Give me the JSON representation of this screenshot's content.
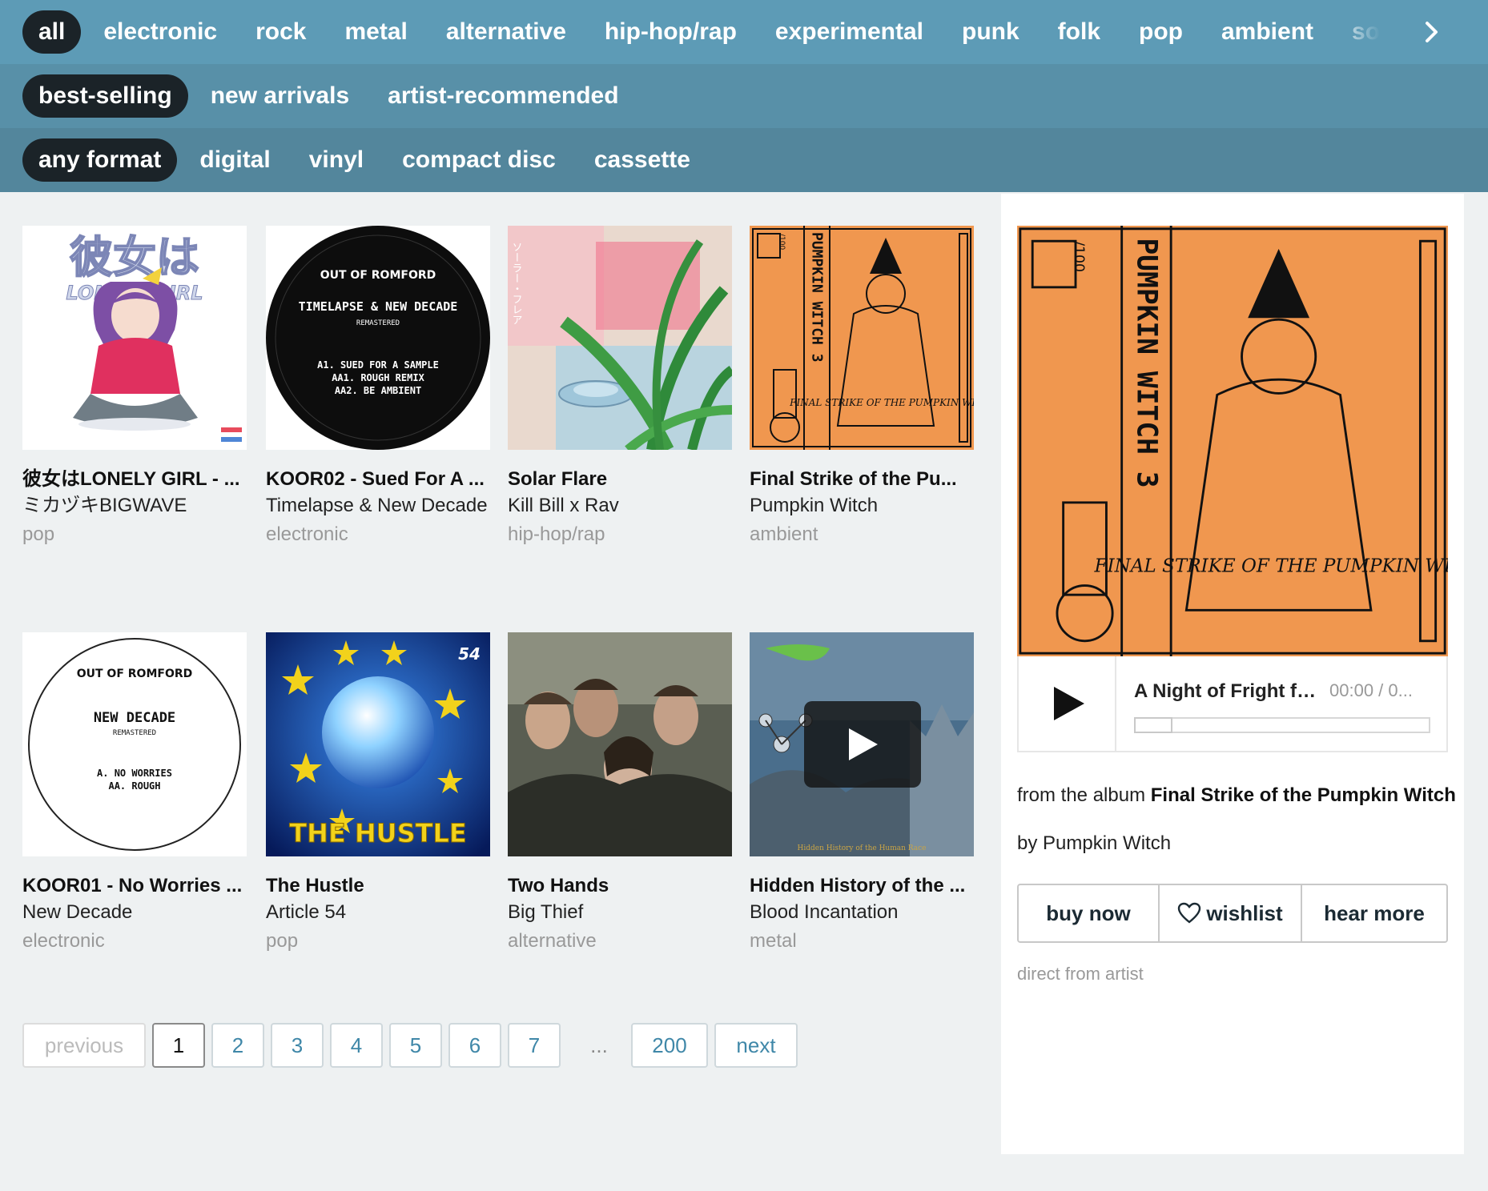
{
  "genre_tabs": [
    "all",
    "electronic",
    "rock",
    "metal",
    "alternative",
    "hip-hop/rap",
    "experimental",
    "punk",
    "folk",
    "pop",
    "ambient",
    "soundtra"
  ],
  "active_genre": "all",
  "sort_tabs": [
    "best-selling",
    "new arrivals",
    "artist-recommended"
  ],
  "format_tabs": [
    "any format",
    "digital",
    "vinyl",
    "compact disc",
    "cassette"
  ],
  "colors": {
    "bar_top": "#5d9bb6",
    "bar_mid": "#5890a8",
    "bar_bottom": "#53869c",
    "pill_active": "#1b2328",
    "link": "#3f87a8",
    "cover_orange": "#f0974f"
  },
  "items": [
    {
      "title": "彼女はLONELY GIRL - ...",
      "artist": "ミカヅキBIGWAVE",
      "genre": "pop"
    },
    {
      "title": "KOOR02 - Sued For A ...",
      "artist": "Timelapse & New Decade",
      "genre": "electronic"
    },
    {
      "title": "Solar Flare",
      "artist": "Kill Bill x Rav",
      "genre": "hip-hop/rap"
    },
    {
      "title": "Final Strike of the Pu...",
      "artist": "Pumpkin Witch",
      "genre": "ambient"
    },
    {
      "title": "KOOR01 - No Worries ...",
      "artist": "New Decade",
      "genre": "electronic"
    },
    {
      "title": "The Hustle",
      "artist": "Article 54",
      "genre": "pop"
    },
    {
      "title": "Two Hands",
      "artist": "Big Thief",
      "genre": "alternative"
    },
    {
      "title": "Hidden History of the ...",
      "artist": "Blood Incantation",
      "genre": "metal"
    }
  ],
  "covers": {
    "c1": {
      "jp_title": "彼女は",
      "en_sub": "LONELY GIRL"
    },
    "c2": {
      "label": "OUT OF ROMFORD",
      "title": "TIMELAPSE & NEW DECADE",
      "remastered": "REMASTERED",
      "tracks": [
        "A1. SUED FOR A SAMPLE",
        "AA1. ROUGH REMIX",
        "AA2. BE AMBIENT"
      ]
    },
    "c3": {
      "jp": "ソーラー・フレア"
    },
    "c4": {
      "spine": "PUMPKIN WITCH 3",
      "num": "/100",
      "art_text": "FINAL STRIKE OF THE PUMPKIN WITCH"
    },
    "c5": {
      "label": "OUT OF ROMFORD",
      "title": "NEW DECADE",
      "remastered": "REMASTERED",
      "tracks": [
        "A. NO WORRIES",
        "AA. ROUGH"
      ]
    },
    "c6": {
      "title": "THE HUSTLE",
      "badge": "54"
    },
    "c8": {
      "caption": "Hidden History of the Human Race"
    }
  },
  "pagination": {
    "previous": "previous",
    "pages": [
      "1",
      "2",
      "3",
      "4",
      "5",
      "6",
      "7"
    ],
    "current": "1",
    "ellipsis": "...",
    "last": "200",
    "next": "next"
  },
  "player": {
    "track": "A Night of Fright for...",
    "time": "00:00 / 0...",
    "from_prefix": "from the album ",
    "album": "Final Strike of the Pumpkin Witch",
    "by": "by Pumpkin Witch",
    "buy": "buy now",
    "wishlist": "wishlist",
    "hear_more": "hear more",
    "direct": "direct from artist",
    "progress": 0
  }
}
